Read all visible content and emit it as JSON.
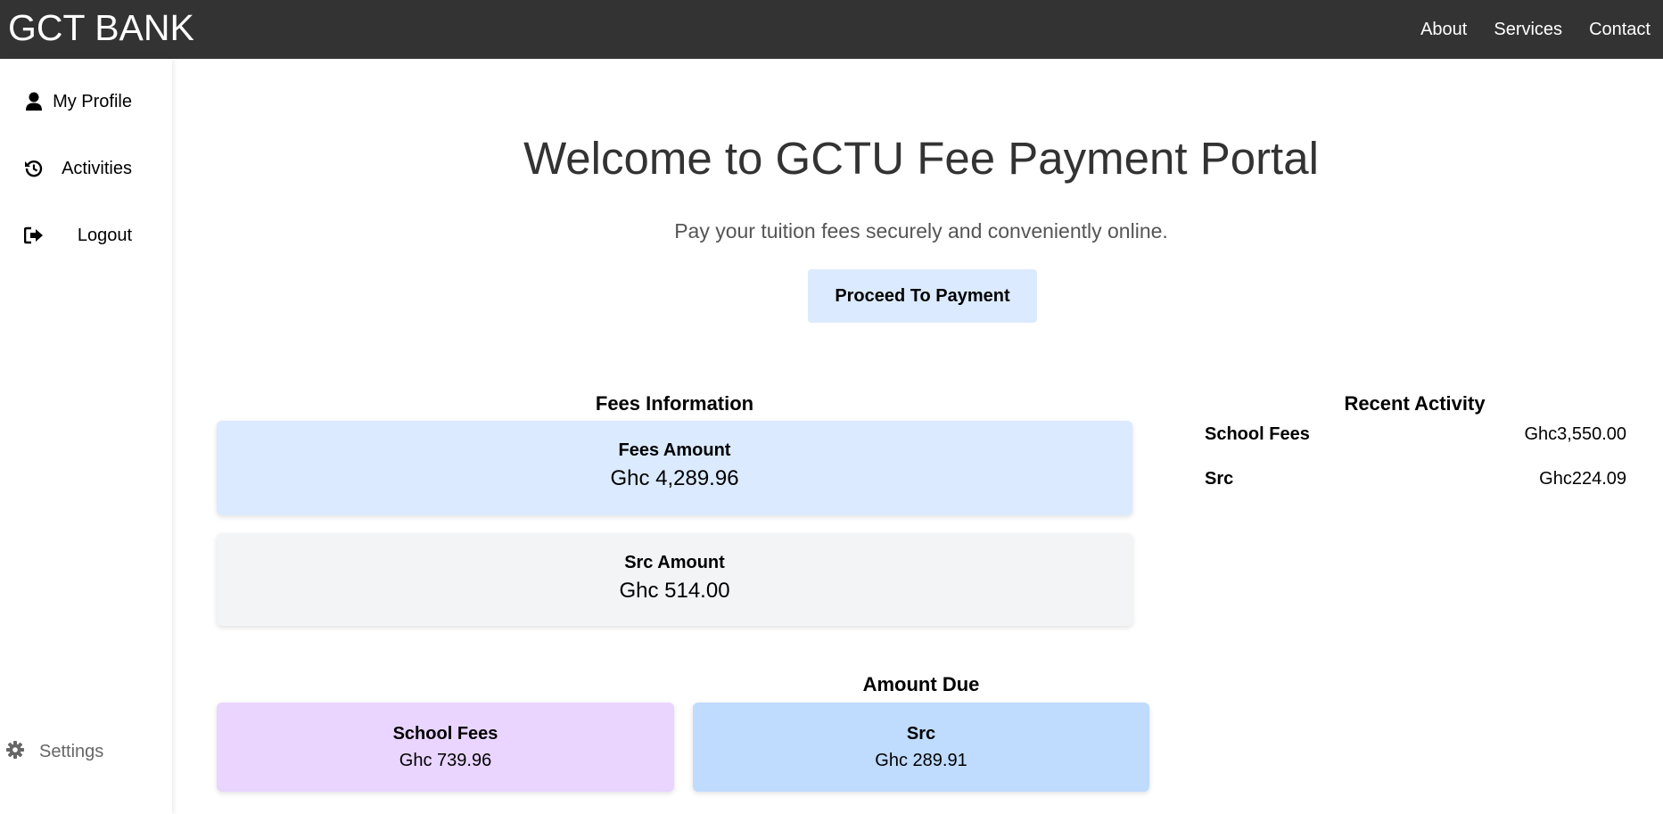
{
  "header": {
    "brand": "GCT BANK",
    "nav": [
      "About",
      "Services",
      "Contact"
    ]
  },
  "sidebar": {
    "items": [
      {
        "label": "My Profile",
        "icon": "user-icon"
      },
      {
        "label": "Activities",
        "icon": "history-icon"
      },
      {
        "label": "Logout",
        "icon": "logout-icon"
      }
    ],
    "settings": {
      "label": "Settings",
      "icon": "gear-icon"
    }
  },
  "hero": {
    "title": "Welcome to GCTU Fee Payment Portal",
    "subtitle": "Pay your tuition fees securely and conveniently online.",
    "button": "Proceed To Payment"
  },
  "fees_info": {
    "title": "Fees Information",
    "cards": [
      {
        "title": "Fees Amount",
        "value": "Ghc 4,289.96",
        "color": "#dbeafe"
      },
      {
        "title": "Src Amount",
        "value": "Ghc 514.00",
        "color": "#f3f4f6"
      }
    ]
  },
  "amount_due": {
    "title": "Amount Due",
    "cards": [
      {
        "title": "School Fees",
        "value": "Ghc 739.96",
        "color": "#e9d5ff"
      },
      {
        "title": "Src",
        "value": "Ghc 289.91",
        "color": "#bfdbfe"
      }
    ]
  },
  "recent_activity": {
    "title": "Recent Activity",
    "rows": [
      {
        "name": "School Fees",
        "amount": "Ghc3,550.00"
      },
      {
        "name": "Src",
        "amount": "Ghc224.09"
      }
    ]
  }
}
